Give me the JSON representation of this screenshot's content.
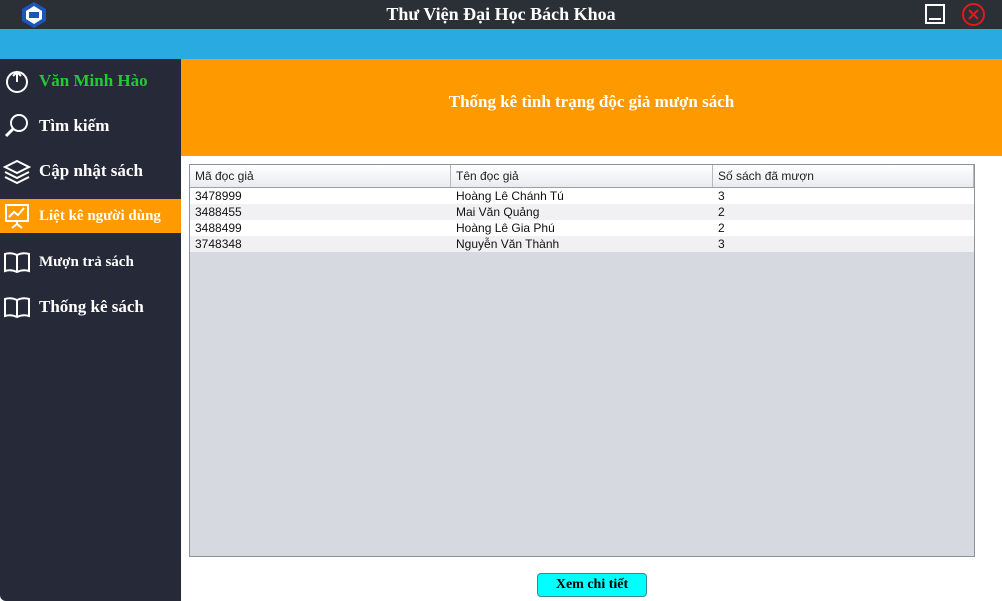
{
  "window": {
    "title": "Thư Viện Đại Học Bách Khoa"
  },
  "sidebar": {
    "items": [
      {
        "label": "Văn Minh Hào",
        "icon": "power-icon"
      },
      {
        "label": "Tìm kiếm",
        "icon": "search-icon"
      },
      {
        "label": "Cập nhật sách",
        "icon": "layers-icon"
      },
      {
        "label": "Liệt kê người dùng",
        "icon": "presentation-chart-icon",
        "active": true
      },
      {
        "label": "Mượn trả sách",
        "icon": "book-icon"
      },
      {
        "label": "Thống kê sách",
        "icon": "book-icon"
      }
    ]
  },
  "header": {
    "title": "Thống kê tình trạng độc giả mượn sách"
  },
  "table": {
    "columns": [
      "Mã đọc giả",
      "Tên đọc giả",
      "Số sách đã mượn"
    ],
    "rows": [
      [
        "3478999",
        "Hoàng Lê Chánh Tú",
        "3"
      ],
      [
        "3488455",
        "Mai Văn Quảng",
        "2"
      ],
      [
        "3488499",
        "Hoàng Lê Gia Phú",
        "2"
      ],
      [
        "3748348",
        "Nguyễn Văn Thành",
        "3"
      ]
    ]
  },
  "actions": {
    "detail_label": "Xem chi tiết"
  },
  "colors": {
    "titlebar": "#2b2f36",
    "accent_bar": "#29abe2",
    "sidebar": "#262938",
    "header": "#ff9900",
    "active_item": "#ff9b00",
    "user_name": "#1fcc33",
    "button": "#00ffff"
  }
}
